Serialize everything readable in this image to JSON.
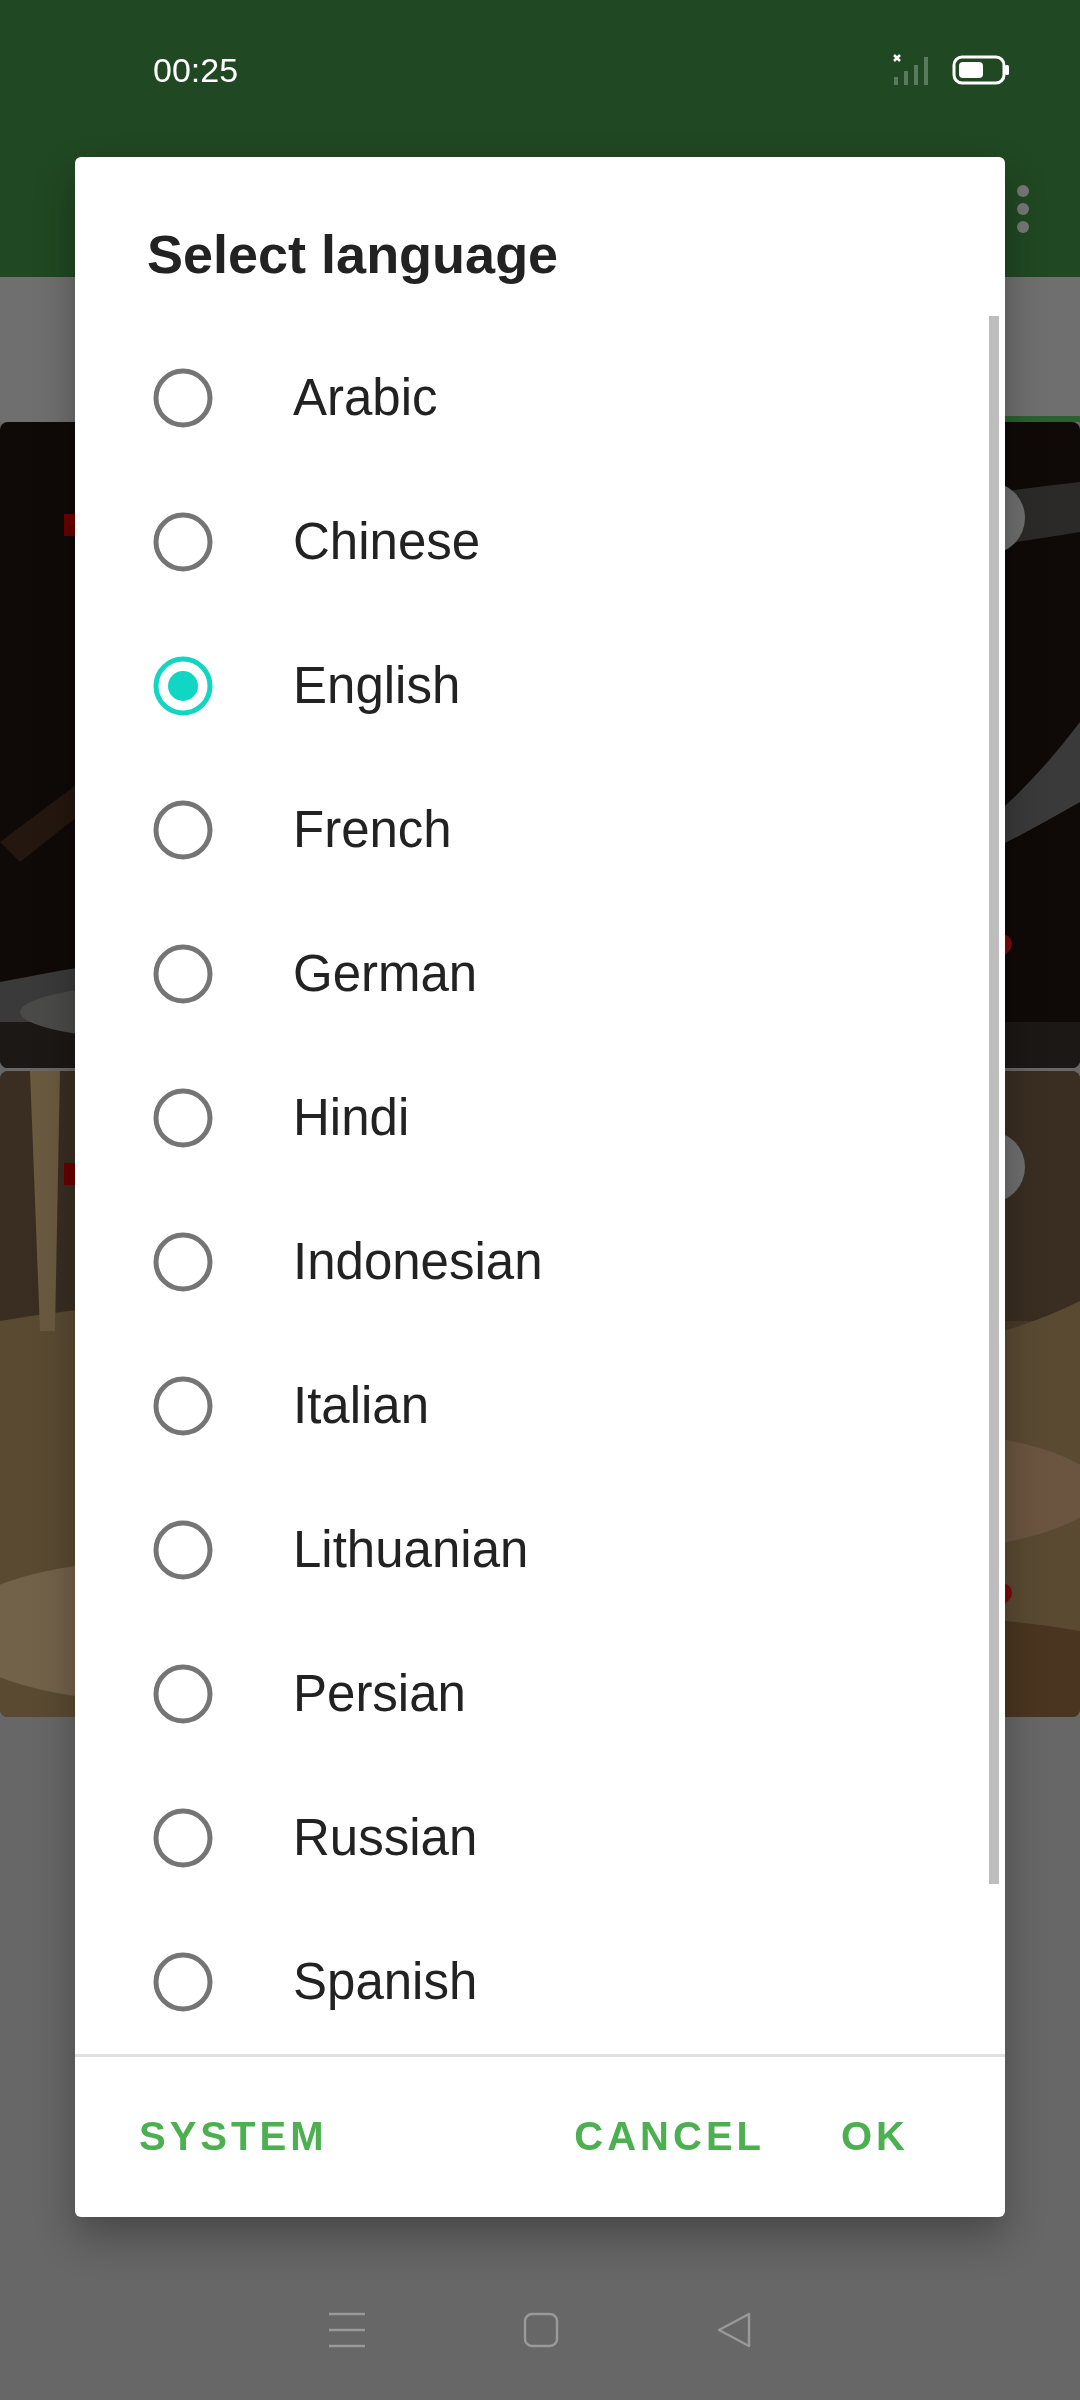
{
  "status_bar": {
    "time": "00:25"
  },
  "dialog": {
    "title": "Select language",
    "options": [
      {
        "label": "Arabic",
        "selected": false
      },
      {
        "label": "Chinese",
        "selected": false
      },
      {
        "label": "English",
        "selected": true
      },
      {
        "label": "French",
        "selected": false
      },
      {
        "label": "German",
        "selected": false
      },
      {
        "label": "Hindi",
        "selected": false
      },
      {
        "label": "Indonesian",
        "selected": false
      },
      {
        "label": "Italian",
        "selected": false
      },
      {
        "label": "Lithuanian",
        "selected": false
      },
      {
        "label": "Persian",
        "selected": false
      },
      {
        "label": "Russian",
        "selected": false
      },
      {
        "label": "Spanish",
        "selected": false
      }
    ],
    "buttons": {
      "neutral": "SYSTEM",
      "negative": "CANCEL",
      "positive": "OK"
    }
  }
}
